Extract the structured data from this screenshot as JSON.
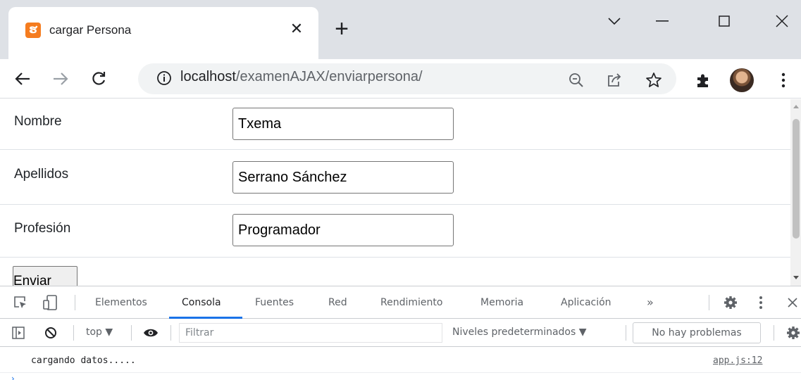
{
  "browser": {
    "tab": {
      "favicon_glyph": "ຮ",
      "title": "cargar Persona",
      "close_glyph": "✕"
    },
    "new_tab_glyph": "+",
    "window": {
      "chevron_glyph": "⌄",
      "minimize_glyph": "—",
      "maximize_glyph": "☐",
      "close_glyph": "✕"
    },
    "address": {
      "host": "localhost",
      "path": "/examenAJAX/enviarpersona/"
    },
    "colors": {
      "favicon": "#f57c1f",
      "tabstrip": "#dee1e6",
      "devtools_accent": "#1a73e8"
    }
  },
  "form": {
    "fields": [
      {
        "label": "Nombre",
        "value": "Txema"
      },
      {
        "label": "Apellidos",
        "value": "Serrano Sánchez"
      },
      {
        "label": "Profesión",
        "value": "Programador"
      }
    ],
    "submit_label": "Enviar"
  },
  "devtools": {
    "tabs": [
      "Elementos",
      "Consola",
      "Fuentes",
      "Red",
      "Rendimiento",
      "Memoria",
      "Aplicación"
    ],
    "active_tab": "Consola",
    "more_tabs_glyph": "»",
    "context": "top",
    "filter_placeholder": "Filtrar",
    "levels_label": "Niveles predeterminados",
    "issues_label": "No hay problemas",
    "console": [
      {
        "message": "cargando datos.....",
        "source": "app.js:12"
      }
    ]
  }
}
